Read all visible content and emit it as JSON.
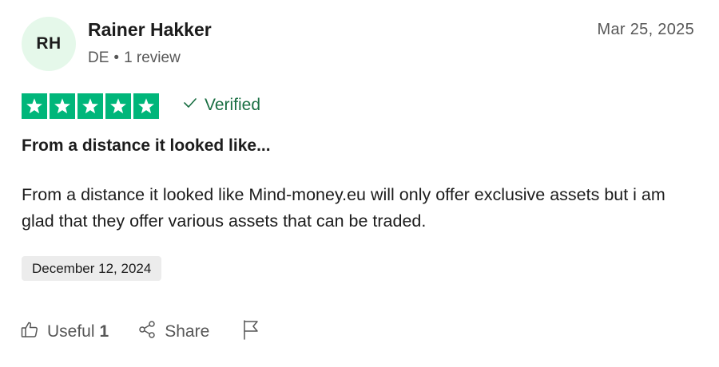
{
  "reviewer": {
    "initials": "RH",
    "name": "Rainer Hakker",
    "country": "DE",
    "separator": "•",
    "review_count": "1 review",
    "avatar_color": "#e5f8ea"
  },
  "review": {
    "date": "Mar 25, 2025",
    "rating": 5,
    "rating_color": "#00b67a",
    "verified_label": "Verified",
    "title": "From a distance it looked like...",
    "body": "From a distance it looked like Mind-money.eu will only offer exclusive assets but i am glad that they offer various assets that can be traded.",
    "experience_date": "December 12, 2024"
  },
  "actions": {
    "useful_label": "Useful",
    "useful_count": "1",
    "share_label": "Share",
    "useful_icon": "thumbs-up-icon",
    "share_icon": "share-icon",
    "report_icon": "flag-icon"
  }
}
